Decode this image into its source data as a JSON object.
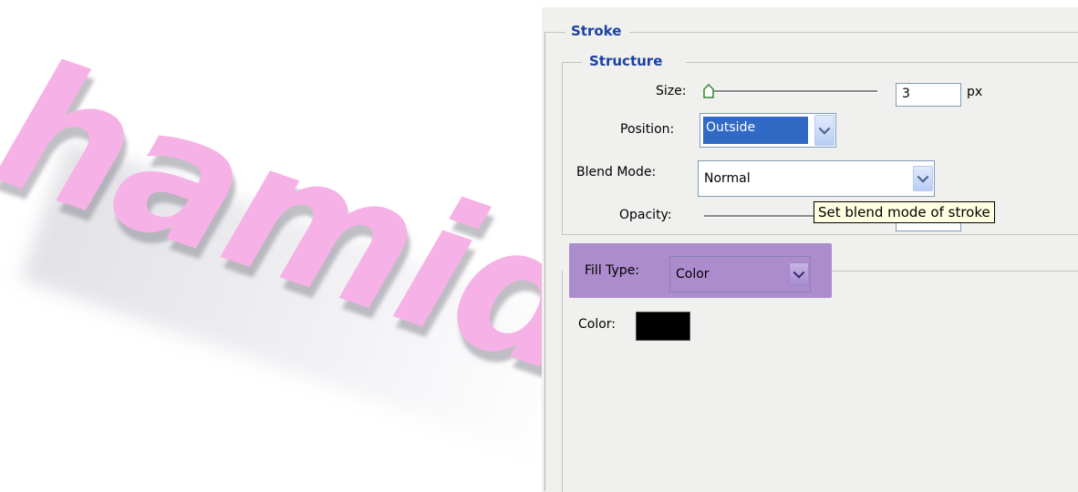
{
  "watermark": {
    "text": "hamid"
  },
  "stroke": {
    "title": "Stroke"
  },
  "structure": {
    "title": "Structure",
    "size": {
      "label": "Size:",
      "value": "3",
      "unit": "px"
    },
    "position": {
      "label": "Position:",
      "value": "Outside"
    },
    "blend_mode": {
      "label": "Blend Mode:",
      "value": "Normal"
    },
    "opacity": {
      "label": "Opacity:"
    }
  },
  "tooltip": {
    "text": "Set blend mode of stroke"
  },
  "fill": {
    "type_label": "Fill Type:",
    "type_value": "Color",
    "color_label": "Color:",
    "color_value": "#000000"
  },
  "colors": {
    "group_title": "#1b41a3",
    "highlight": "#ad8ccd",
    "selection": "#316ac5",
    "watermark": "#f6b1e6"
  },
  "icons": {
    "slider_thumb": "slider-thumb-icon",
    "dropdown": "chevron-down-icon"
  }
}
